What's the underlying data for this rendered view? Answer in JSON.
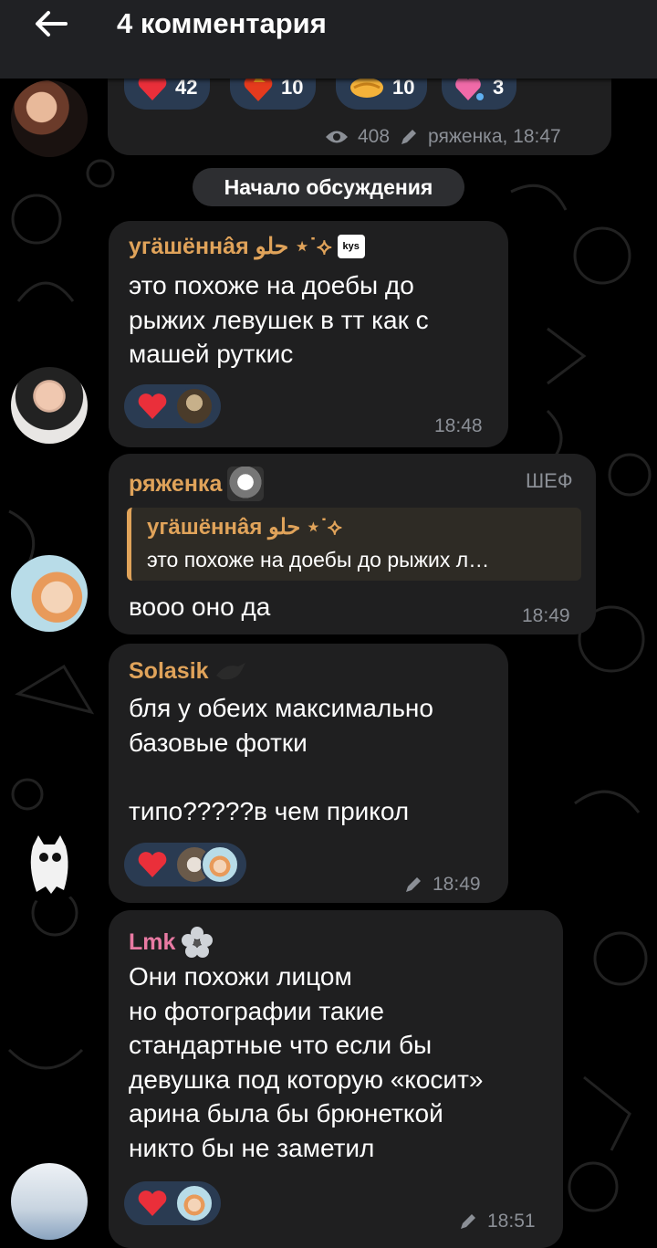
{
  "header": {
    "title": "4 комментария"
  },
  "colors": {
    "heart": "#ea2f3a",
    "reaction_bg": "#2a3b52",
    "bubble": "#1f1f20",
    "name_orange": "#e0a35a",
    "name_pink": "#e97aa3"
  },
  "post": {
    "reactions": [
      {
        "icon": "heart-icon",
        "count": "42"
      },
      {
        "icon": "heart-on-fire-icon",
        "count": "10"
      },
      {
        "icon": "handshake-icon",
        "count": "10"
      },
      {
        "icon": "heart-sparkle-icon",
        "count": "3"
      }
    ],
    "views": "408",
    "signature": "ряженка, 18:47"
  },
  "divider": {
    "label": "Начало обсуждения"
  },
  "messages": [
    {
      "author": "угäшённâя حلو ⋆˙⟡",
      "text": "это похоже на доебы до\nрыжих левушек в тт как с\nмашей руткис",
      "time": "18:48"
    },
    {
      "author": "ряженка",
      "badge": "ШЕФ",
      "reply_author": "угäшённâя حلو ⋆˙⟡",
      "reply_text": "это похоже на доебы до рыжих л…",
      "text": "вооо оно да",
      "time": "18:49"
    },
    {
      "author": "Solasik",
      "text": "бля у обеих максимально\nбазовые фотки\n\nтипо?????в чем прикол",
      "time": "18:49"
    },
    {
      "author": "Lmk",
      "text": "Они похожи лицом\nно фотографии такие\nстандартные что если бы\nдевушка под которую «косит»\nарина была бы брюнеткой\nникто бы не заметил",
      "time": "18:51"
    }
  ]
}
